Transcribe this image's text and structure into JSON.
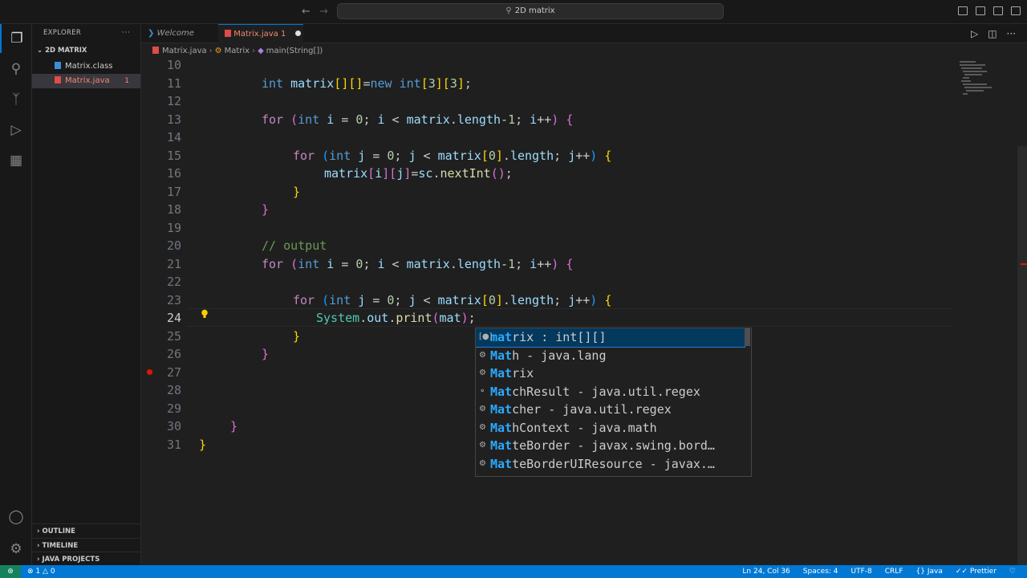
{
  "window": {
    "title": "2D matrix"
  },
  "explorer": {
    "header": "EXPLORER",
    "folder": "2D MATRIX",
    "files": [
      {
        "name": "Matrix.class",
        "badge": ""
      },
      {
        "name": "Matrix.java",
        "badge": "1"
      }
    ],
    "sections": [
      "OUTLINE",
      "TIMELINE",
      "JAVA PROJECTS"
    ]
  },
  "tabs": [
    {
      "label": "Welcome",
      "icon": "vscode-icon"
    },
    {
      "label": "Matrix.java 1",
      "icon": "java-file-icon",
      "dirty": true
    }
  ],
  "breadcrumb": [
    "Matrix.java",
    "Matrix",
    "main(String[])"
  ],
  "editor": {
    "line_numbers": [
      "10",
      "11",
      "12",
      "13",
      "14",
      "15",
      "16",
      "17",
      "18",
      "19",
      "20",
      "21",
      "22",
      "23",
      "24",
      "25",
      "26",
      "27",
      "28",
      "29",
      "30",
      "31"
    ],
    "current_line": "24"
  },
  "suggestions": [
    {
      "icon": "field-icon",
      "match": "mat",
      "rest": "rix : int[][]"
    },
    {
      "icon": "class-icon",
      "match": "Mat",
      "rest": "h - java.lang"
    },
    {
      "icon": "class-icon",
      "match": "Mat",
      "rest": "rix"
    },
    {
      "icon": "interface-icon",
      "match": "Mat",
      "rest": "chResult - java.util.regex"
    },
    {
      "icon": "class-icon",
      "match": "Mat",
      "rest": "cher - java.util.regex"
    },
    {
      "icon": "class-icon",
      "match": "Mat",
      "rest": "hContext - java.math"
    },
    {
      "icon": "class-icon",
      "match": "Mat",
      "rest": "teBorder - javax.swing.bord…"
    },
    {
      "icon": "class-icon",
      "match": "Mat",
      "rest": "teBorderUIResource - javax.…"
    }
  ],
  "status": {
    "errors": "1",
    "warnings": "0",
    "position": "Ln 24, Col 36",
    "spaces": "Spaces: 4",
    "encoding": "UTF-8",
    "eol": "CRLF",
    "language": "Java",
    "formatter": "Prettier"
  },
  "colors": {
    "accent": "#0078d4",
    "error": "#f48771",
    "keyword": "#569cd6",
    "control": "#c586c0"
  }
}
